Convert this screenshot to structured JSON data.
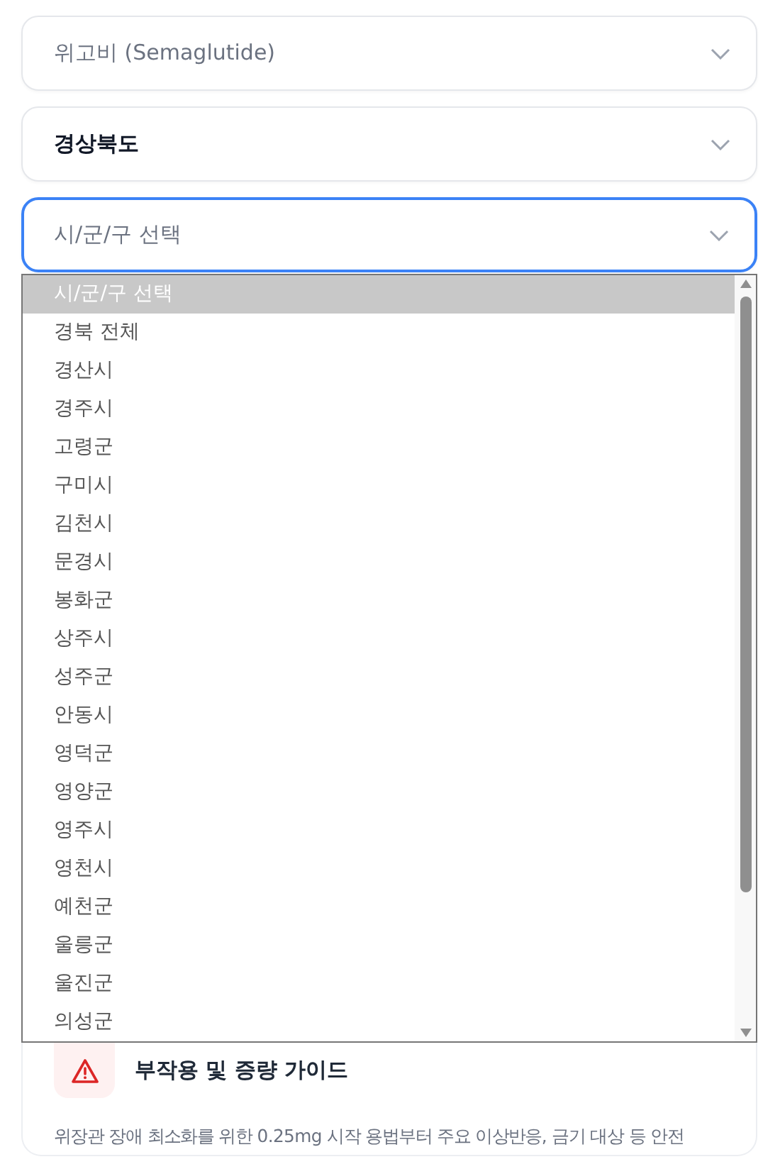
{
  "selects": [
    {
      "value": "위고비 (Semaglutide)",
      "disabled": true,
      "focused": false
    },
    {
      "value": "경상북도",
      "disabled": false,
      "focused": false
    },
    {
      "placeholder": "시/군/구 선택",
      "disabled": false,
      "focused": true,
      "open": true
    }
  ],
  "dropdown": {
    "options": [
      {
        "label": "시/군/구 선택",
        "selected": true
      },
      {
        "label": "경북 전체",
        "selected": false
      },
      {
        "label": "경산시",
        "selected": false
      },
      {
        "label": "경주시",
        "selected": false
      },
      {
        "label": "고령군",
        "selected": false
      },
      {
        "label": "구미시",
        "selected": false
      },
      {
        "label": "김천시",
        "selected": false
      },
      {
        "label": "문경시",
        "selected": false
      },
      {
        "label": "봉화군",
        "selected": false
      },
      {
        "label": "상주시",
        "selected": false
      },
      {
        "label": "성주군",
        "selected": false
      },
      {
        "label": "안동시",
        "selected": false
      },
      {
        "label": "영덕군",
        "selected": false
      },
      {
        "label": "영양군",
        "selected": false
      },
      {
        "label": "영주시",
        "selected": false
      },
      {
        "label": "영천시",
        "selected": false
      },
      {
        "label": "예천군",
        "selected": false
      },
      {
        "label": "울릉군",
        "selected": false
      },
      {
        "label": "울진군",
        "selected": false
      },
      {
        "label": "의성군",
        "selected": false
      }
    ]
  },
  "guide_card": {
    "title": "부작용 및 증량 가이드",
    "description": "위장관 장애 최소화를 위한 0.25mg 시작 용법부터 주요 이상반응, 금기 대상 등 안전"
  }
}
